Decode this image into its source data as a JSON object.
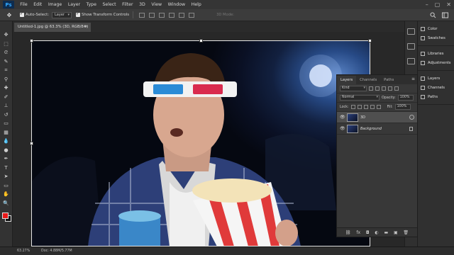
{
  "app": {
    "logo": "Ps",
    "menu": [
      "File",
      "Edit",
      "Image",
      "Layer",
      "Type",
      "Select",
      "Filter",
      "3D",
      "View",
      "Window",
      "Help"
    ],
    "window_controls": {
      "minimize": "–",
      "maximize": "▢",
      "close": "✕"
    }
  },
  "options_bar": {
    "auto_select_label": "Auto-Select:",
    "auto_select_value": "Layer",
    "show_transform_label": "Show Transform Controls",
    "mode_3d_label": "3D Mode:"
  },
  "document": {
    "tab_title": "Untitled-1.jpg @ 63.3% (3D, RGB/8#) *",
    "close_glyph": "×"
  },
  "right_panels": [
    {
      "label": "Color",
      "icon": "color-icon"
    },
    {
      "label": "Swatches",
      "icon": "swatches-icon"
    },
    {
      "label": "Libraries",
      "icon": "libraries-icon"
    },
    {
      "label": "Adjustments",
      "icon": "adjustments-icon"
    },
    {
      "label": "Layers",
      "icon": "layers-icon"
    },
    {
      "label": "Channels",
      "icon": "channels-icon"
    },
    {
      "label": "Paths",
      "icon": "paths-icon"
    }
  ],
  "layers_panel": {
    "tabs": [
      "Layers",
      "Channels",
      "Paths"
    ],
    "filter_kind": "Kind",
    "blend_mode": "Normal",
    "opacity_label": "Opacity:",
    "opacity_value": "100%",
    "lock_label": "Lock:",
    "fill_label": "Fill:",
    "fill_value": "100%",
    "layers": [
      {
        "name": "3D",
        "selected": true,
        "italic": false
      },
      {
        "name": "Background",
        "selected": false,
        "italic": true
      }
    ],
    "bottom_icons": [
      "link-icon",
      "fx-icon",
      "mask-icon",
      "adjustment-icon",
      "folder-icon",
      "new-layer-icon",
      "trash-icon"
    ],
    "bottom_glyphs": [
      "⛓",
      "fx",
      "◘",
      "◐",
      "▬",
      "▣",
      "🗑"
    ]
  },
  "status_bar": {
    "zoom": "63.27%",
    "doc_info": "Doc: 4.88M/5.77M"
  },
  "colors": {
    "foreground": "#e81919",
    "background": "#111111",
    "accent": "#31a8ff"
  }
}
